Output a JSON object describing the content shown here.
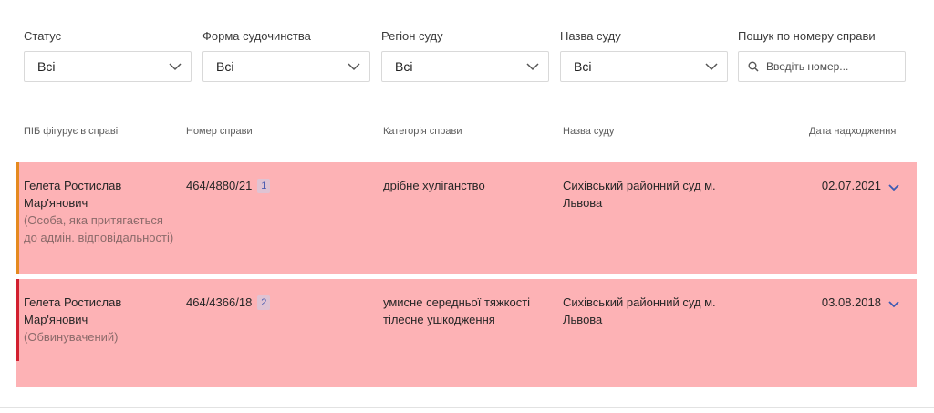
{
  "filters": {
    "status": {
      "label": "Статус",
      "value": "Всі"
    },
    "form": {
      "label": "Форма судочинства",
      "value": "Всі"
    },
    "region": {
      "label": "Регіон суду",
      "value": "Всі"
    },
    "court": {
      "label": "Назва суду",
      "value": "Всі"
    },
    "search": {
      "label": "Пошук по номеру справи",
      "placeholder": "Введіть номер..."
    }
  },
  "table": {
    "headers": {
      "name": "ПІБ фігурує в справі",
      "number": "Номер справи",
      "category": "Категорія справи",
      "court": "Назва суду",
      "date": "Дата надходження"
    },
    "rows": [
      {
        "name_line1": "Гелета Ростислав",
        "name_line2": "Мар'янович",
        "role": "(Особа, яка притягається до адмін. відповідальності)",
        "number": "464/4880/21",
        "badge": "1",
        "category": "дрібне хуліганство",
        "court": "Сихівський районний суд м. Львова",
        "date": "02.07.2021",
        "accent": "#e58a1f"
      },
      {
        "name_line1": "Гелета Ростислав",
        "name_line2": "Мар'янович",
        "role": "(Обвинувачений)",
        "number": "464/4366/18",
        "badge": "2",
        "category": "умисне середньої тяжкості тілесне ушкодження",
        "court": "Сихівський районний суд м. Львова",
        "date": "03.08.2018",
        "accent": "#d21f2f"
      }
    ]
  },
  "colors": {
    "row_bg": "#fdb2b5",
    "chevron": "#3b5ab3"
  },
  "icons": {
    "select": "chevron-down-icon",
    "search": "search-icon",
    "expand": "chevron-down-icon"
  }
}
